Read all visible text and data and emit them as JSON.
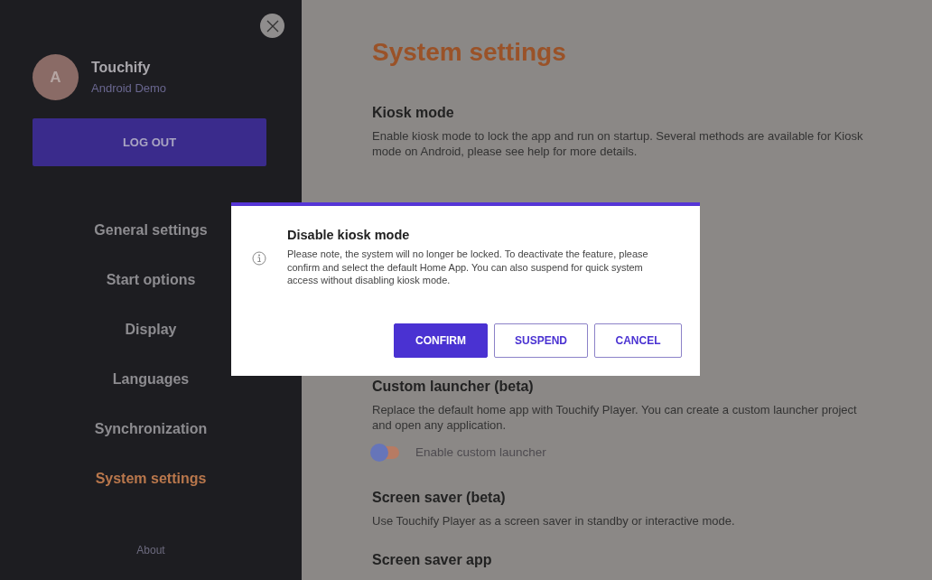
{
  "sidebar": {
    "avatar": {
      "initial": "A"
    },
    "user": {
      "name": "Touchify",
      "subtitle": "Android Demo"
    },
    "logout_button": "LOG OUT",
    "items": [
      {
        "label": "General settings",
        "selected": false
      },
      {
        "label": "Start options",
        "selected": false
      },
      {
        "label": "Display",
        "selected": false
      },
      {
        "label": "Languages",
        "selected": false
      },
      {
        "label": "Synchronization",
        "selected": false
      },
      {
        "label": "System settings",
        "selected": true
      }
    ],
    "footer_link": "About"
  },
  "page": {
    "title": "System settings",
    "sections": [
      {
        "heading": "Kiosk mode",
        "description": "Enable kiosk mode to lock the app and run on startup. Several methods are available for Kiosk mode on Android, please see help for more details."
      },
      {
        "heading": "Custom launcher (beta)",
        "description": "Replace the default home app with Touchify Player. You can create a custom launcher project and open any application.",
        "toggle": {
          "label": "Enable custom launcher",
          "on": false
        }
      },
      {
        "heading": "Screen saver (beta)",
        "description": "Use Touchify Player as a screen saver in standby or interactive mode."
      },
      {
        "heading": "Screen saver app"
      }
    ]
  },
  "dialog": {
    "title": "Disable kiosk mode",
    "message": "Please note, the system will no longer be locked. To deactivate the feature, please confirm and select the default Home App. You can also suspend for quick system access without disabling kiosk mode.",
    "buttons": [
      {
        "label": "CONFIRM",
        "kind": "primary"
      },
      {
        "label": "SUSPEND",
        "kind": "outline"
      },
      {
        "label": "CANCEL",
        "kind": "outline"
      }
    ]
  }
}
